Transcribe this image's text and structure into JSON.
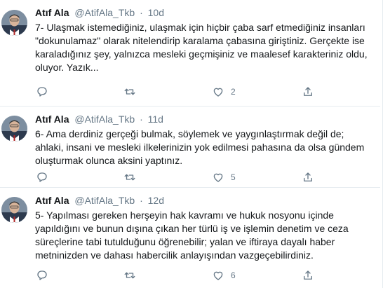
{
  "tweets": [
    {
      "name": "Atıf Ala",
      "handle": "@AtifAla_Tkb",
      "dot": "·",
      "time": "10d",
      "text": "7- Ulaşmak istemediğiniz, ulaşmak için hiçbir çaba sarf etmediğiniz insanları \"dokunulamaz\" olarak nitelendirip karalama çabasına giriştiniz. Gerçekte ise karaladığınız şey, yalnızca mesleki geçmişiniz ve maalesef karakteriniz oldu, oluyor. Yazık...",
      "likes": "2"
    },
    {
      "name": "Atıf Ala",
      "handle": "@AtifAla_Tkb",
      "dot": "·",
      "time": "11d",
      "text": "6- Ama derdiniz gerçeği bulmak, söylemek ve yaygınlaştırmak değil de; ahlaki, insani ve mesleki ilkelerinizin yok edilmesi pahasına da olsa gündem oluşturmak olunca aksini yaptınız.",
      "likes": "5"
    },
    {
      "name": "Atıf Ala",
      "handle": "@AtifAla_Tkb",
      "dot": "·",
      "time": "12d",
      "text": "5- Yapılması gereken herşeyin hak kavramı ve hukuk nosyonu içinde yapıldığını ve bunun dışına çıkan her türlü iş ve işlemin denetim ve ceza süreçlerine tabi tutulduğunu öğrenebilir; yalan ve iftiraya dayalı haber metninizden ve dahası habercilik anlayışından vazgeçebilirdiniz.",
      "likes": "6"
    }
  ],
  "icons": {
    "reply": "reply-icon",
    "retweet": "retweet-icon",
    "like": "heart-icon",
    "share": "share-icon"
  },
  "colors": {
    "text": "#14171a",
    "muted": "#657786",
    "divider": "#e6ecf0"
  }
}
